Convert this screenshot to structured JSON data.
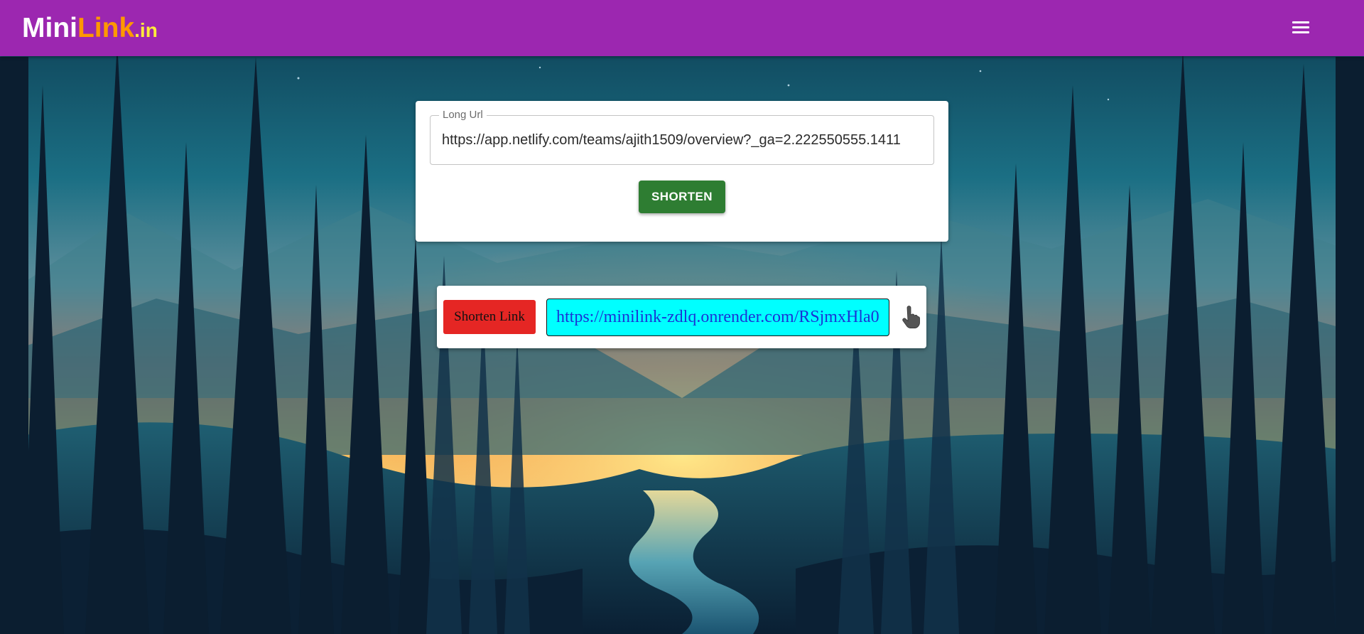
{
  "app": {
    "brand": {
      "part_mini": "Mini",
      "part_link": "Link",
      "part_tld": ".in"
    },
    "menu_icon": "hamburger-menu-icon"
  },
  "colors": {
    "appbar": "#9c27b0",
    "brand_mini": "#ffffff",
    "brand_link": "#ff9800",
    "brand_tld": "#ffeb3b",
    "shorten_button": "#2e7d32",
    "result_label_bg": "#e52624",
    "result_url_bg": "#00ffff",
    "result_url_text": "#1a33d6"
  },
  "form": {
    "long_url_label": "Long Url",
    "long_url_value": "https://app.netlify.com/teams/ajith1509/overview?_ga=2.222550555.1411",
    "shorten_button_label": "SHORTEN"
  },
  "result": {
    "label": "Shorten Link",
    "short_url": "https://minilink-zdlq.onrender.com/RSjmxHla0",
    "copy_icon": "pointer-hand-icon"
  },
  "background": {
    "description_icon": "forest-sunset-illustration"
  }
}
